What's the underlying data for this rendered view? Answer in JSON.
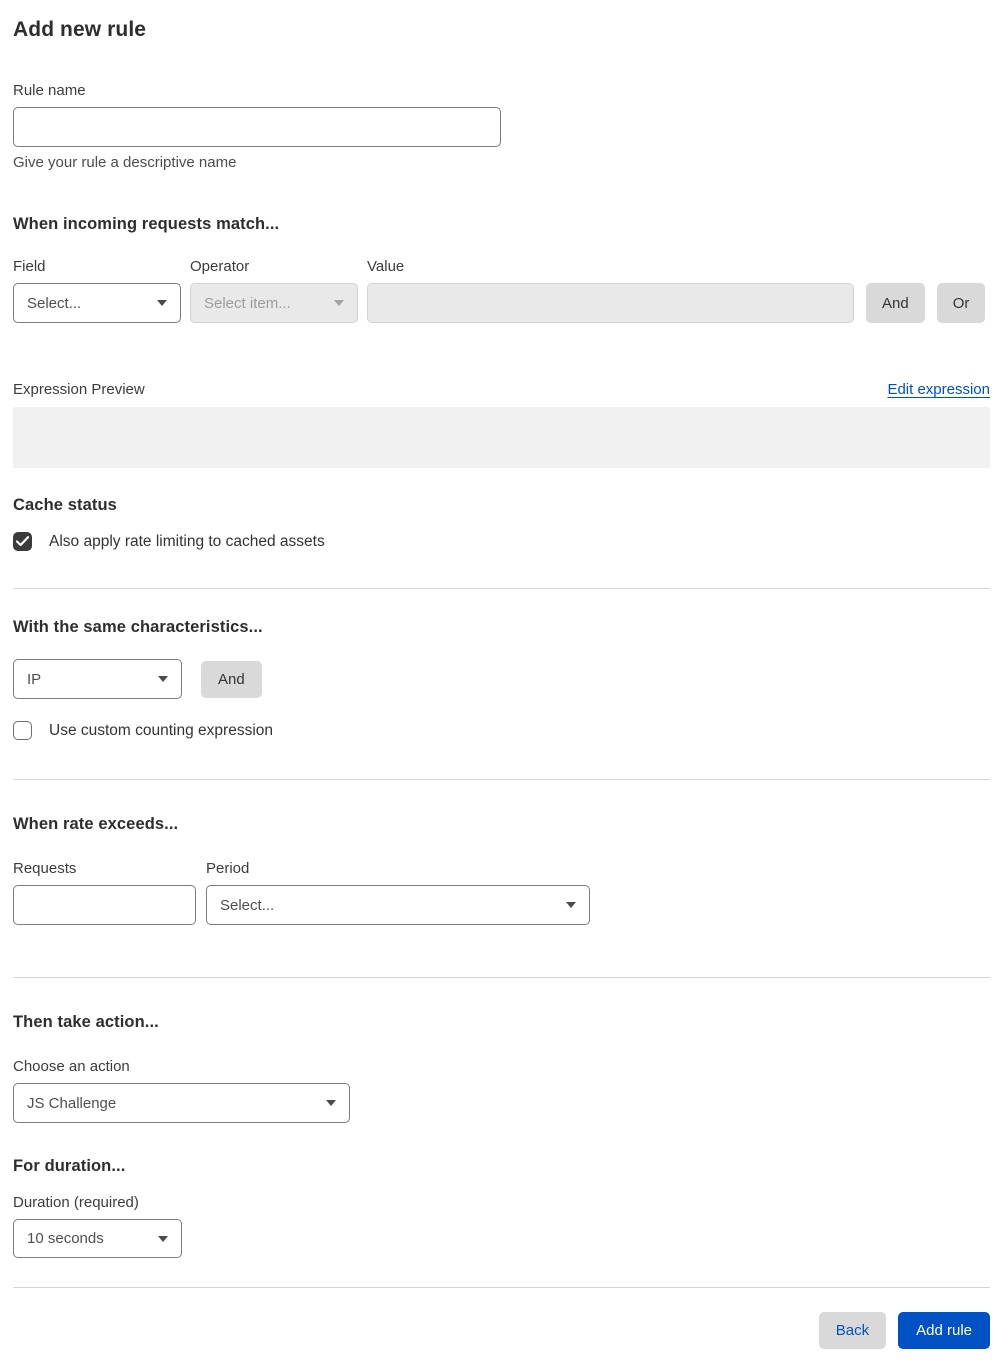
{
  "page": {
    "title": "Add new rule"
  },
  "rule_name": {
    "label": "Rule name",
    "value": "",
    "helper": "Give your rule a descriptive name"
  },
  "match": {
    "heading": "When incoming requests match...",
    "field": {
      "label": "Field",
      "selected": "Select..."
    },
    "operator": {
      "label": "Operator",
      "selected": "Select item...",
      "disabled": true
    },
    "value": {
      "label": "Value",
      "value": "",
      "disabled": true
    },
    "and_label": "And",
    "or_label": "Or"
  },
  "expression": {
    "label": "Expression Preview",
    "edit_link": "Edit expression",
    "value": ""
  },
  "cache": {
    "heading": "Cache status",
    "checkbox_label": "Also apply rate limiting to cached assets",
    "checked": true
  },
  "characteristics": {
    "heading": "With the same characteristics...",
    "selected": "IP",
    "and_label": "And",
    "checkbox_label": "Use custom counting expression",
    "checked": false
  },
  "rate": {
    "heading": "When rate exceeds...",
    "requests_label": "Requests",
    "requests_value": "",
    "period_label": "Period",
    "period_selected": "Select..."
  },
  "action": {
    "heading": "Then take action...",
    "label": "Choose an action",
    "selected": "JS Challenge"
  },
  "duration": {
    "heading": "For duration...",
    "label": "Duration (required)",
    "selected": "10 seconds"
  },
  "footer": {
    "back_label": "Back",
    "submit_label": "Add rule"
  },
  "colors": {
    "primary_blue": "#0051c3",
    "link_blue": "#0051c3",
    "checkbox_checked": "#3b3b3b",
    "disabled_bg": "#e9e9e9",
    "button_gray": "#d9d9d9",
    "divider": "#d5d5d5",
    "expression_box_bg": "#f1f1f1"
  }
}
